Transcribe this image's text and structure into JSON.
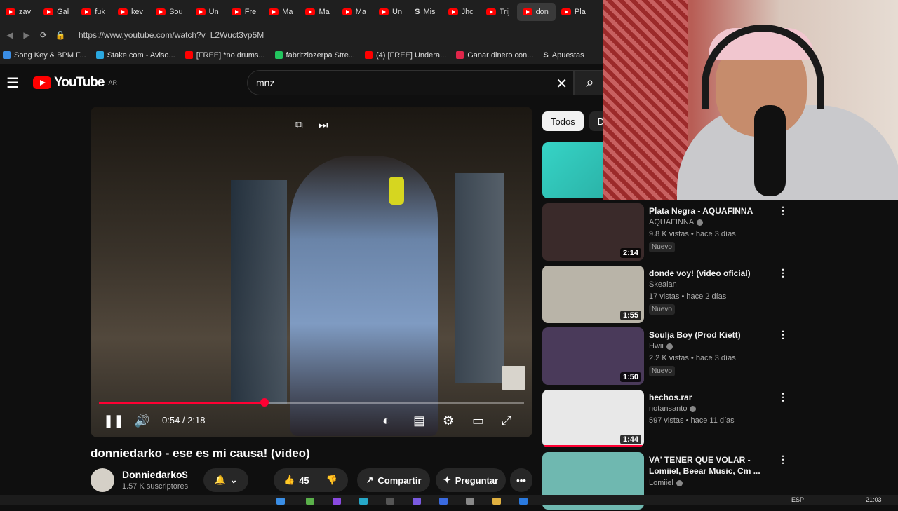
{
  "tabs": [
    "zav",
    "Gal",
    "fuk",
    "kev",
    "Sou",
    "Un",
    "Fre",
    "Ma",
    "Ma",
    "Ma",
    "Un",
    "Mis",
    "Jhc",
    "Trij",
    "don",
    "Pla"
  ],
  "active_tab_index": 14,
  "address": {
    "url": "https://www.youtube.com/watch?v=L2Wuct3vp5M"
  },
  "bookmarks": [
    "Song Key & BPM F...",
    "Stake.com - Aviso...",
    "[FREE] *no drums...",
    "fabritziozerpa Stre...",
    "(4) [FREE] Undera...",
    "Ganar dinero con...",
    "Apuestas"
  ],
  "youtube": {
    "logo_text": "YouTube",
    "region": "AR",
    "search_value": "mnz"
  },
  "player": {
    "current_time": "0:54",
    "duration": "2:18",
    "time_display": "0:54 / 2:18",
    "progress": 0.39
  },
  "video": {
    "title": "donniedarko - ese es mi causa! (video)",
    "channel": "Donniedarko$",
    "subscribers": "1.57 K suscriptores",
    "likes": "45",
    "share_label": "Compartir",
    "ask_label": "Preguntar"
  },
  "chips": [
    "Todos",
    "De"
  ],
  "recommendations": [
    {
      "title": "Plata Negra - AQUAFINNA",
      "channel": "AQUAFINNA",
      "verified": true,
      "meta": "9.8 K vistas • hace 3 días",
      "badge": "Nuevo",
      "duration": "2:14",
      "thumb_color": "#3a2a2a"
    },
    {
      "title": "donde voy! (video oficial)",
      "channel": "Skealan",
      "verified": false,
      "meta": "17 vistas • hace 2 días",
      "badge": "Nuevo",
      "duration": "1:55",
      "thumb_color": "#b9b4a8"
    },
    {
      "title": "Soulja Boy (Prod Kiett)",
      "channel": "Hwii",
      "verified": true,
      "meta": "2.2 K vistas • hace 3 días",
      "badge": "Nuevo",
      "duration": "1:50",
      "thumb_color": "#4a3a5a"
    },
    {
      "title": "hechos.rar",
      "channel": "notansanto",
      "verified": true,
      "meta": "597 vistas • hace 11 días",
      "badge": "",
      "duration": "1:44",
      "thumb_color": "#e8e8e8"
    },
    {
      "title": "VA' TENER QUE VOLAR - Lomiiel, Beear Music, Cm ...",
      "channel": "Lomiiel",
      "verified": true,
      "meta": "",
      "badge": "",
      "duration": "",
      "thumb_color": "#6fb8b0"
    }
  ],
  "taskbar": {
    "lang": "ESP",
    "clock": "21:03"
  }
}
